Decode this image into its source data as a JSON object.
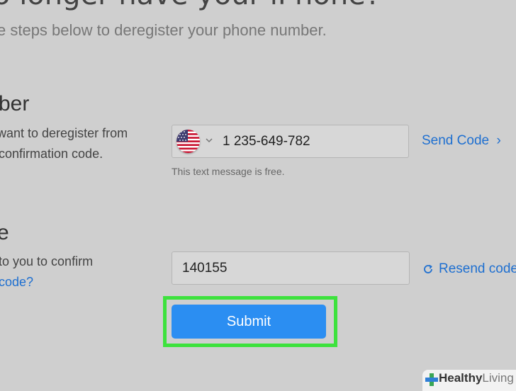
{
  "header": {
    "title": "o longer have your iPhone?",
    "subtitle": "e steps below to deregister your phone number."
  },
  "phone_section": {
    "title": "ber",
    "desc_line1": "want to deregister from",
    "desc_line2": "confirmation code.",
    "phone_value": "1 235-649-782",
    "send_code_label": "Send Code",
    "note": "This text message is free."
  },
  "code_section": {
    "title": "e",
    "desc_line1": "to you to confirm",
    "desc_link": "code?",
    "code_value": "140155",
    "resend_label": "Resend code"
  },
  "submit_label": "Submit",
  "watermark": {
    "bold": "Healthy",
    "light": "Living"
  },
  "colors": {
    "link": "#1e6fd0",
    "submit": "#2b8ef2",
    "highlight": "#3de23d"
  }
}
